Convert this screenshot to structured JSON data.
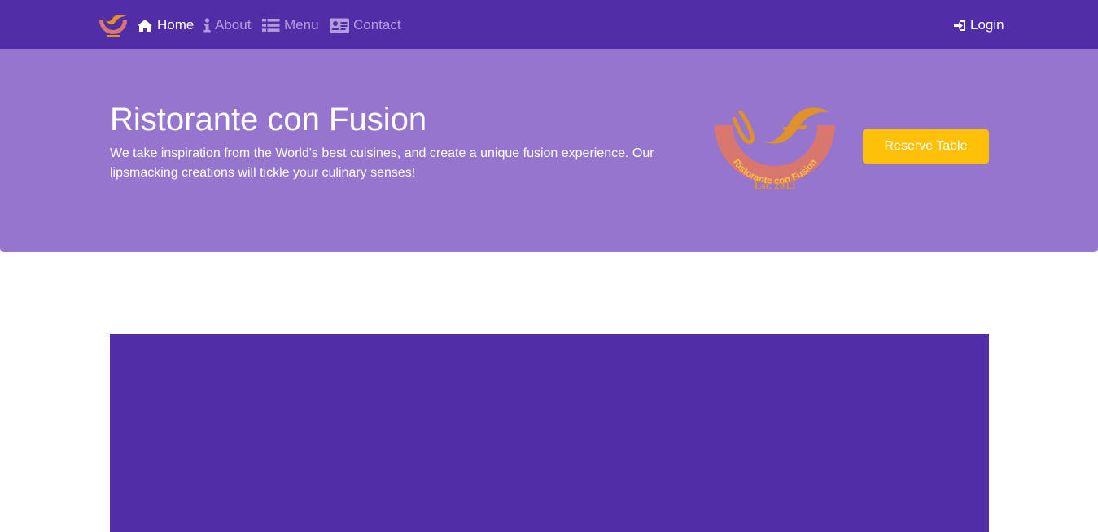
{
  "navbar": {
    "items": [
      {
        "label": "Home",
        "icon": "home-icon",
        "active": true
      },
      {
        "label": "About",
        "icon": "info-icon",
        "active": false
      },
      {
        "label": "Menu",
        "icon": "list-icon",
        "active": false
      },
      {
        "label": "Contact",
        "icon": "address-card-icon",
        "active": false
      }
    ],
    "login_label": "Login",
    "login_icon": "sign-in-icon"
  },
  "hero": {
    "title": "Ristorante con Fusion",
    "description": "We take inspiration from the World's best cuisines, and create a unique fusion experience. Our lipsmacking creations will tickle your culinary senses!",
    "reserve_label": "Reserve Table",
    "logo": {
      "arc_text": "Ristorante con Fusion",
      "est_text": "Est. 2013"
    }
  },
  "colors": {
    "primary": "#512DA8",
    "jumbotron": "#9575CD",
    "accent": "#FFC107",
    "nav_inactive": "#B39DDB",
    "logo_arc": "#D9776E",
    "logo_gold": "#E0912A"
  }
}
